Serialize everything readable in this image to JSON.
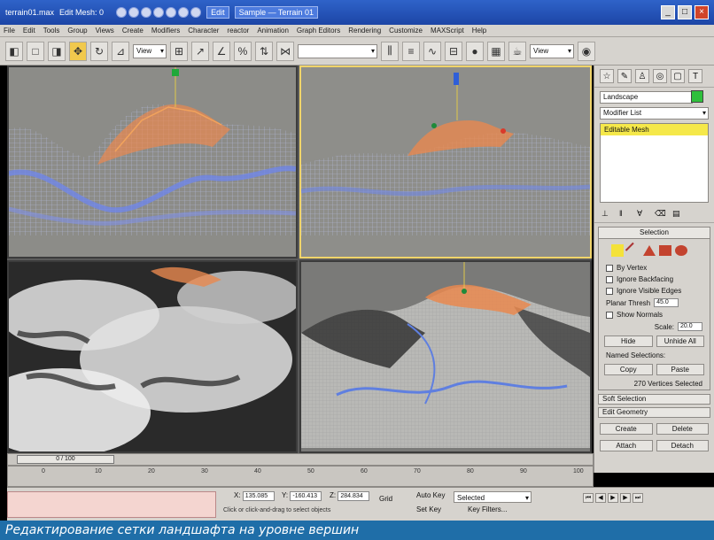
{
  "titlebar": {
    "title": "terrain01.max",
    "mode": "Edit Mesh: 0",
    "task1": "Edit",
    "task2": "Sample — Terrain 01"
  },
  "menu": [
    "File",
    "Edit",
    "Tools",
    "Group",
    "Views",
    "Create",
    "Modifiers",
    "Character",
    "reactor",
    "Animation",
    "Graph Editors",
    "Rendering",
    "Customize",
    "MAXScript",
    "Help"
  ],
  "toolbar": {
    "selection_filter": "View",
    "named_sel": "",
    "view_combo": "View"
  },
  "command_panel": {
    "object_name": "Landscape",
    "modifier_list": "Modifier List",
    "stack_selected": "Editable Mesh",
    "selection_rollout": "Selection",
    "by_vertex": "By Vertex",
    "ignore_backfacing": "Ignore Backfacing",
    "ignore_visible_edges": "Ignore Visible Edges",
    "planar_thresh": "Planar Thresh",
    "planar_value": "45.0",
    "show_normals": "Show Normals",
    "scale_label": "Scale:",
    "scale_value": "20.0",
    "hide": "Hide",
    "unhide_all": "Unhide All",
    "named_selections": "Named Selections:",
    "copy": "Copy",
    "paste": "Paste",
    "status": "270 Vertices Selected",
    "soft_selection": "Soft Selection",
    "edit_geometry": "Edit Geometry",
    "create": "Create",
    "delete": "Delete",
    "attach": "Attach",
    "detach": "Detach"
  },
  "timeline": {
    "slider": "0 / 100",
    "ticks": [
      "0",
      "10",
      "20",
      "30",
      "40",
      "50",
      "60",
      "70",
      "80",
      "90",
      "100"
    ]
  },
  "status": {
    "x_label": "X:",
    "x_value": "135.085",
    "y_label": "Y:",
    "y_value": "-160.413",
    "z_label": "Z:",
    "z_value": "284.834",
    "grid": "Grid",
    "autokey": "Auto Key",
    "selected": "Selected",
    "setkey": "Set Key",
    "keyfilters": "Key Filters...",
    "prompt": "Click or click-and-drag to select objects"
  },
  "caption": "Редактирование сетки ландшафта на уровне вершин"
}
